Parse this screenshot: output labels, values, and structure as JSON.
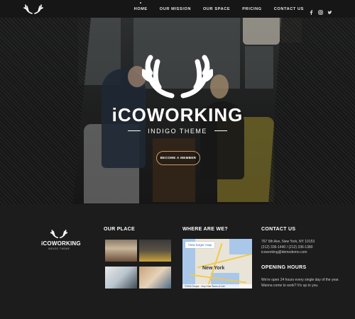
{
  "nav": {
    "items": [
      "HOME",
      "OUR MISSION",
      "OUR SPACE",
      "PRICING",
      "CONTACT US"
    ],
    "social_icons": [
      "facebook-icon",
      "instagram-icon",
      "twitter-icon"
    ]
  },
  "hero": {
    "title": "iCOWORKING",
    "subtitle": "INDIGO THEME",
    "cta_label": "BECOME A MEMBER"
  },
  "footer": {
    "logo_name": "iCOWORKING",
    "logo_tag": "INDIGO THEME",
    "place_heading": "OUR PLACE",
    "where_heading": "WHERE ARE WE?",
    "map": {
      "button": "View larger map",
      "city": "New York",
      "attribution": "©2016 Google · Map Data    Terms of Use"
    },
    "contact_heading": "CONTACT US",
    "contact_lines": [
      "767 5th Ave, New York, NY 10153",
      "(212) 336-1440 / (212) 336-1380",
      "icoworking@demodemo.com"
    ],
    "hours_heading": "OPENING HOURS",
    "hours_text": "We're open 24 hours every single day of the year. Wanna come to work? It's up to you."
  },
  "colors": {
    "accent": "#c49a6c",
    "background": "#1c1c1c",
    "nav": "#161616"
  }
}
